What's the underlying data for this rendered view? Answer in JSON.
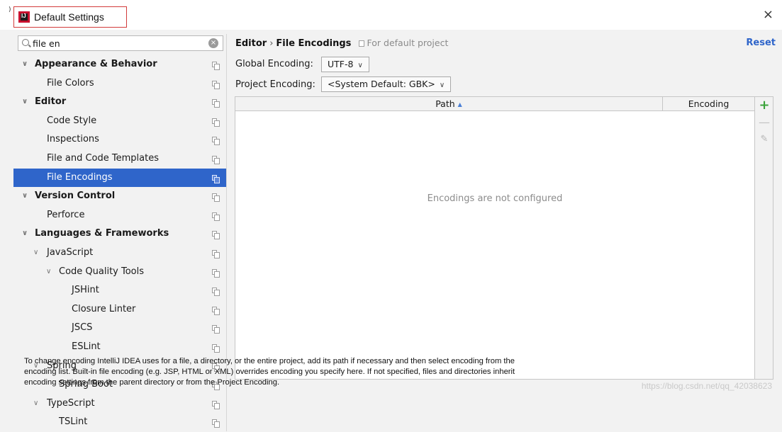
{
  "window": {
    "title": "Default Settings",
    "tiny_mark": ")",
    "app_icon_text": "IJ",
    "close_symbol": "×"
  },
  "search": {
    "value": "file en",
    "clear_symbol": "×"
  },
  "tree": {
    "items": [
      {
        "label": "Appearance & Behavior",
        "bold": true,
        "level": 0,
        "expandable": true,
        "selected": false,
        "icon": "chevron-down-icon"
      },
      {
        "label": "File Colors",
        "bold": false,
        "level": 1,
        "expandable": false,
        "selected": false
      },
      {
        "label": "Editor",
        "bold": true,
        "level": 0,
        "expandable": true,
        "selected": false,
        "icon": "chevron-down-icon"
      },
      {
        "label": "Code Style",
        "bold": false,
        "level": 1,
        "expandable": false,
        "selected": false
      },
      {
        "label": "Inspections",
        "bold": false,
        "level": 1,
        "expandable": false,
        "selected": false
      },
      {
        "label": "File and Code Templates",
        "bold": false,
        "level": 1,
        "expandable": false,
        "selected": false
      },
      {
        "label": "File Encodings",
        "bold": false,
        "level": 1,
        "expandable": false,
        "selected": true
      },
      {
        "label": "Version Control",
        "bold": true,
        "level": 0,
        "expandable": true,
        "selected": false,
        "icon": "chevron-down-icon"
      },
      {
        "label": "Perforce",
        "bold": false,
        "level": 1,
        "expandable": false,
        "selected": false
      },
      {
        "label": "Languages & Frameworks",
        "bold": true,
        "level": 0,
        "expandable": true,
        "selected": false,
        "icon": "chevron-down-icon"
      },
      {
        "label": "JavaScript",
        "bold": false,
        "level": 1,
        "expandable": true,
        "selected": false,
        "icon": "chevron-down-icon"
      },
      {
        "label": "Code Quality Tools",
        "bold": false,
        "level": 2,
        "expandable": true,
        "selected": false,
        "icon": "chevron-down-icon"
      },
      {
        "label": "JSHint",
        "bold": false,
        "level": 3,
        "expandable": false,
        "selected": false
      },
      {
        "label": "Closure Linter",
        "bold": false,
        "level": 3,
        "expandable": false,
        "selected": false
      },
      {
        "label": "JSCS",
        "bold": false,
        "level": 3,
        "expandable": false,
        "selected": false
      },
      {
        "label": "ESLint",
        "bold": false,
        "level": 3,
        "expandable": false,
        "selected": false
      },
      {
        "label": "Spring",
        "bold": false,
        "level": 1,
        "expandable": true,
        "selected": false,
        "icon": "chevron-down-icon"
      },
      {
        "label": "Spring Boot",
        "bold": false,
        "level": 2,
        "expandable": false,
        "selected": false
      },
      {
        "label": "TypeScript",
        "bold": false,
        "level": 1,
        "expandable": true,
        "selected": false,
        "icon": "chevron-down-icon"
      },
      {
        "label": "TSLint",
        "bold": false,
        "level": 2,
        "expandable": false,
        "selected": false
      }
    ]
  },
  "breadcrumb": {
    "section": "Editor",
    "separator": "›",
    "page": "File Encodings",
    "scope": "For default project"
  },
  "reset_label": "Reset",
  "global_encoding": {
    "label": "Global Encoding:",
    "value": "UTF-8"
  },
  "project_encoding": {
    "label": "Project Encoding:",
    "value": "<System Default: GBK>"
  },
  "table": {
    "columns": [
      "Path",
      "Encoding"
    ],
    "sort_indicator": "▲",
    "empty_message": "Encodings are not configured"
  },
  "toolbar": {
    "add_symbol": "+",
    "remove_symbol": "—",
    "edit_symbol": "✎"
  },
  "description": "To change encoding IntelliJ IDEA uses for a file, a directory, or the entire project, add its path if necessary and then select encoding from the encoding list. Built-in file encoding (e.g. JSP, HTML or XML) overrides encoding you specify here. If not specified, files and directories inherit encoding settings from the parent directory or from the Project Encoding.",
  "watermark": "https://blog.csdn.net/qq_42038623",
  "colors": {
    "selection": "#2f65ca",
    "link": "#2f65ca",
    "add_green": "#3aa33a",
    "title_highlight": "#d23b3b"
  }
}
